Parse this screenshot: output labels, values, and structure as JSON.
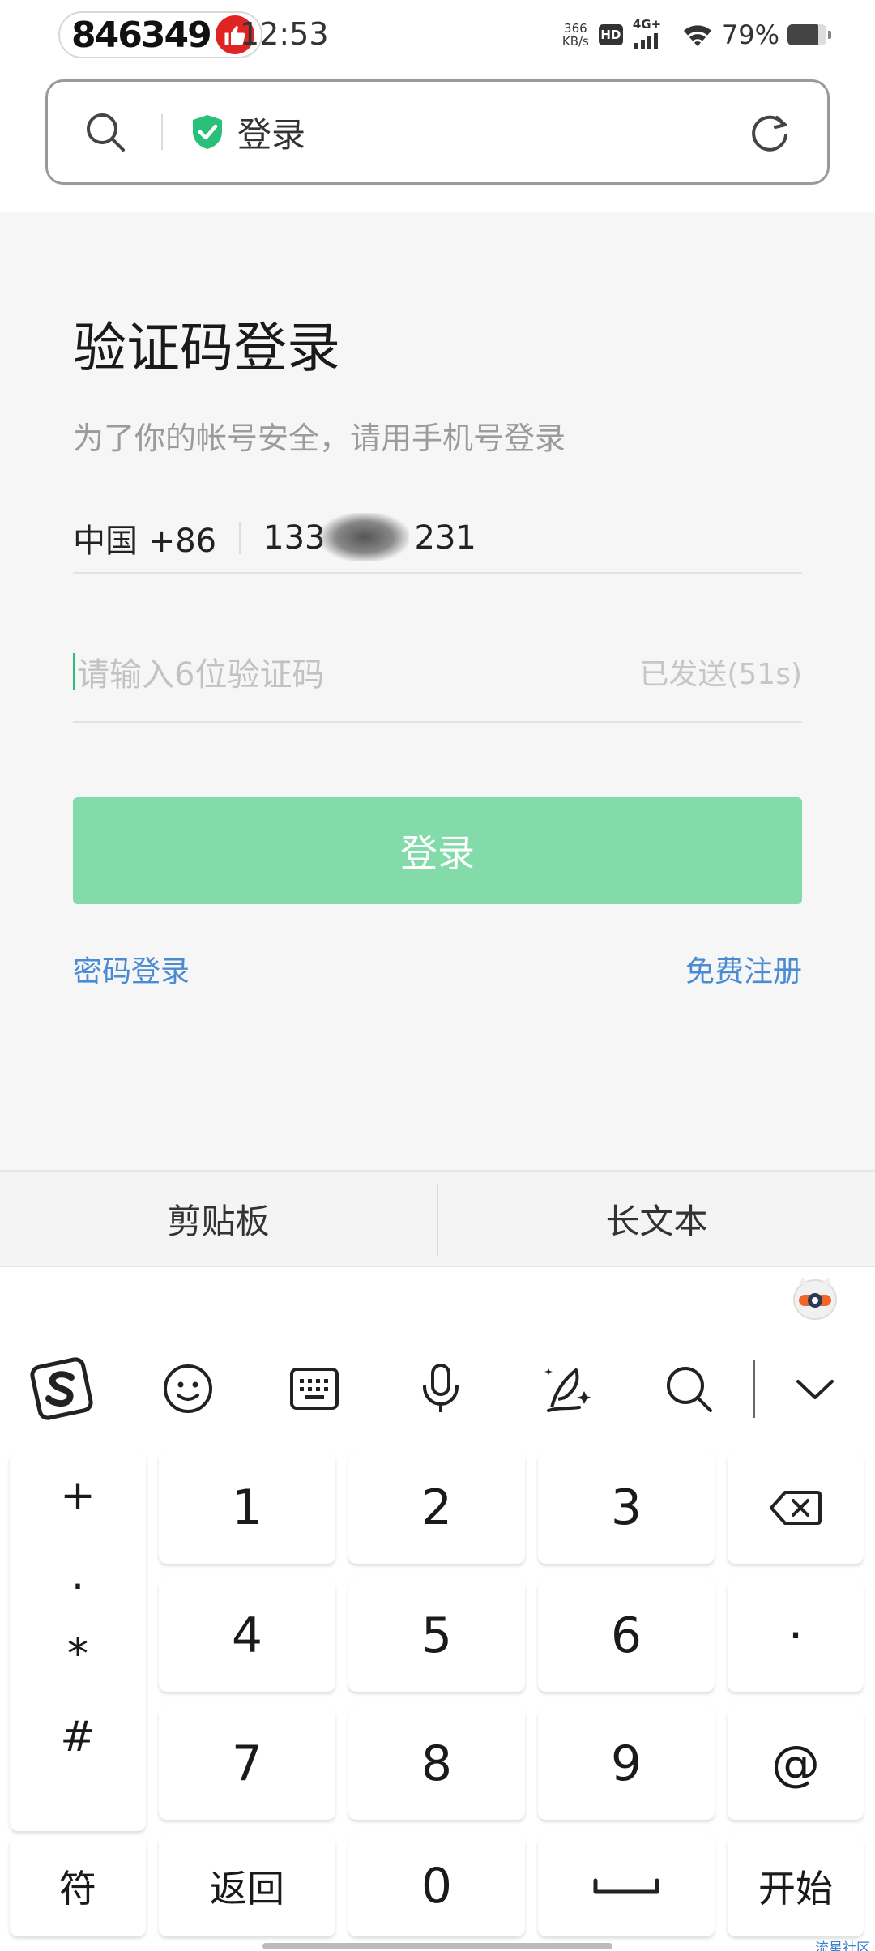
{
  "status_bar": {
    "counter": "846349",
    "time": "12:53",
    "speed_value": "366",
    "speed_unit": "KB/s",
    "hd": "HD",
    "network": "4G+",
    "battery": "79%"
  },
  "address_bar": {
    "title": "登录"
  },
  "login": {
    "title": "验证码登录",
    "subtitle": "为了你的帐号安全，请用手机号登录",
    "country_code": "中国 +86",
    "phone_prefix": "133",
    "phone_suffix": "231",
    "code_placeholder": "请输入6位验证码",
    "sent_status": "已发送(51s)",
    "login_button": "登录",
    "password_login": "密码登录",
    "register": "免费注册"
  },
  "clipboard_bar": {
    "clipboard": "剪贴板",
    "long_text": "长文本"
  },
  "keyboard": {
    "toolbar_icons": [
      "sogou-logo-icon",
      "emoji-icon",
      "keyboard-icon",
      "microphone-icon",
      "handwriting-icon",
      "search-icon",
      "collapse-chevron-icon"
    ],
    "symbols": [
      "+",
      ".",
      "*",
      "#"
    ],
    "row1": [
      "1",
      "2",
      "3"
    ],
    "row2": [
      "4",
      "5",
      "6"
    ],
    "row3": [
      "7",
      "8",
      "9"
    ],
    "dot_key": "·",
    "at_key": "@",
    "sym_key": "符",
    "back_key": "返回",
    "zero_key": "0",
    "start_key": "开始"
  },
  "watermark": "流星社区",
  "colors": {
    "accent_green": "#2bc079",
    "login_button_bg": "#82dba9",
    "link_blue": "#4a8bd4",
    "shield_green": "#2bc079"
  }
}
